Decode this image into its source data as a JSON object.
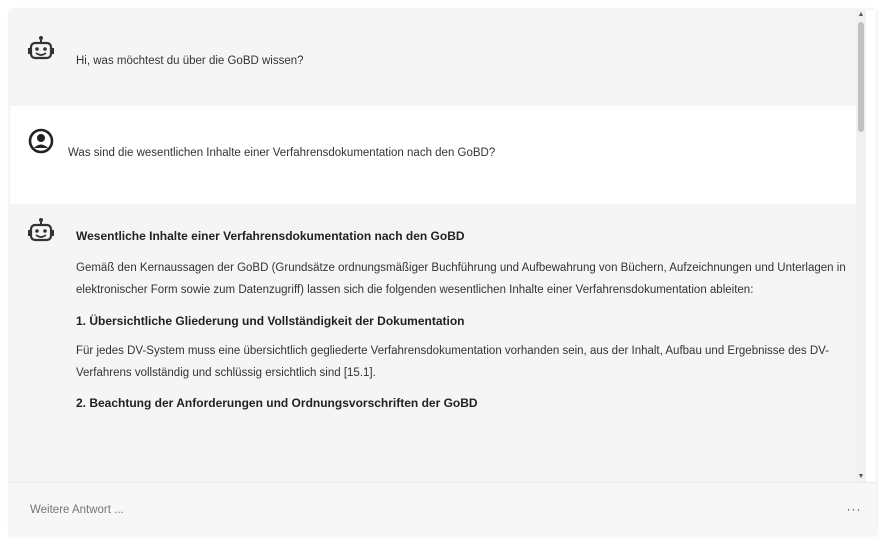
{
  "messages": [
    {
      "role": "bot",
      "text": "Hi, was möchtest du über die GoBD wissen?"
    },
    {
      "role": "user",
      "text": "Was sind die wesentlichen Inhalte einer Verfahrensdokumentation nach den GoBD?"
    },
    {
      "role": "bot",
      "heading": "Wesentliche Inhalte einer Verfahrensdokumentation nach den GoBD",
      "intro": "Gemäß den Kernaussagen der GoBD (Grundsätze ordnungsmäßiger Buchführung und Aufbewahrung von Büchern, Aufzeichnungen und Unterlagen in elektronischer Form sowie zum Datenzugriff) lassen sich die folgenden wesentlichen Inhalte einer Verfahrensdokumentation ableiten:",
      "section1_title": "1. Übersichtliche Gliederung und Vollständigkeit der Dokumentation",
      "section1_text": "Für jedes DV-System muss eine übersichtlich gegliederte Verfahrensdokumentation vorhanden sein, aus der Inhalt, Aufbau und Ergebnisse des DV-Verfahrens vollständig und schlüssig ersichtlich sind [15.1].",
      "section2_title": "2. Beachtung der Anforderungen und Ordnungsvorschriften der GoBD"
    }
  ],
  "input": {
    "placeholder": "Weitere Antwort ..."
  },
  "more_label": "···"
}
